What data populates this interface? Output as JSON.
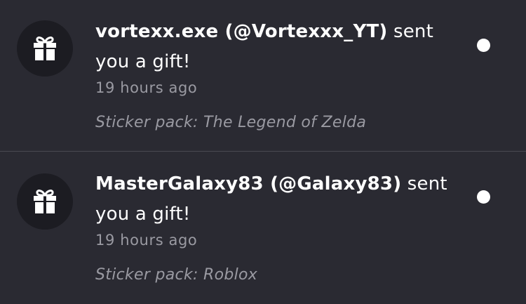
{
  "notifications": [
    {
      "icon": "gift-icon",
      "sender": "vortexx.exe (@Vortexxx_YT)",
      "action": " sent you a gift!",
      "time": "19 hours ago",
      "detail": "Sticker pack: The Legend of Zelda",
      "unread": true
    },
    {
      "icon": "gift-icon",
      "sender": "MasterGalaxy83 (@Galaxy83)",
      "action": " sent you a gift!",
      "time": "19 hours ago",
      "detail": "Sticker pack: Roblox",
      "unread": true
    }
  ],
  "colors": {
    "background": "#2a2a32",
    "avatar_bg": "#1c1c22",
    "text_primary": "#ffffff",
    "text_secondary": "#9a9aa2",
    "divider": "#4a4a52",
    "unread_dot": "#ffffff"
  }
}
